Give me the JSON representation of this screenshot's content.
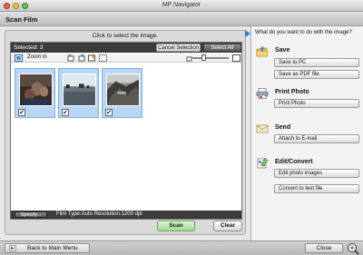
{
  "window": {
    "title": "MP Navigator"
  },
  "mode": {
    "title": "Scan Film"
  },
  "main": {
    "instruction": "Click to select the image.",
    "selected_label": "Selected: 3",
    "cancel_selection": "Cancel Selection",
    "select_all": "Select All",
    "zoom_in": "Zoom in",
    "specify": "Specify...",
    "film_info": "Film Type:Auto   Resolution:1200 dpi",
    "scan": "Scan",
    "clear": "Clear",
    "thumbnails": [
      {
        "name": "photo-1",
        "checked": true
      },
      {
        "name": "photo-2",
        "checked": true
      },
      {
        "name": "photo-3",
        "checked": true
      }
    ]
  },
  "side": {
    "question": "What do you want to do with the image?",
    "sections": [
      {
        "title": "Save",
        "icon": "folder-icon",
        "actions": [
          "Save to PC",
          "Save as PDF file"
        ]
      },
      {
        "title": "Print Photo",
        "icon": "printer-icon",
        "actions": [
          "Print Photo"
        ]
      },
      {
        "title": "Send",
        "icon": "envelope-icon",
        "actions": [
          "Attach to E-mail"
        ]
      },
      {
        "title": "Edit/Convert",
        "icon": "edit-tools-icon",
        "actions": [
          "Edit photo images",
          "Convert to text file"
        ]
      }
    ]
  },
  "bottom": {
    "back": "Back to Main Menu",
    "close": "Close"
  }
}
